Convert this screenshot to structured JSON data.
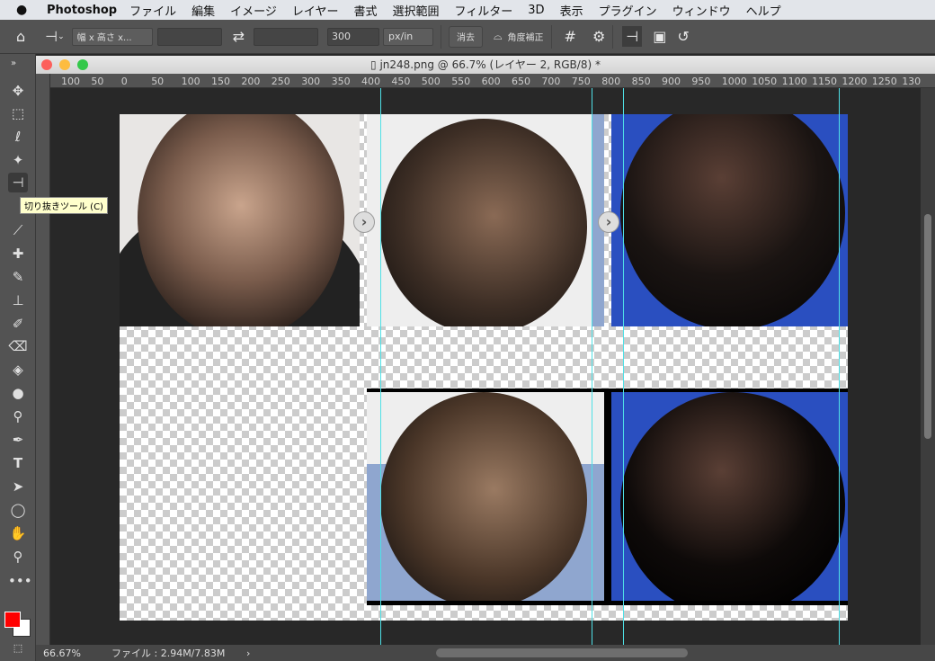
{
  "menubar": {
    "app": "Photoshop",
    "items": [
      "ファイル",
      "編集",
      "イメージ",
      "レイヤー",
      "書式",
      "選択範囲",
      "フィルター",
      "3D",
      "表示",
      "プラグイン",
      "ウィンドウ",
      "ヘルプ"
    ]
  },
  "options": {
    "ratio": "幅 x 高さ x...",
    "width": "",
    "height": "",
    "resolution": "300",
    "unit": "px/in",
    "clear": "消去",
    "straighten": "角度補正"
  },
  "document": {
    "title": "jn248.png @ 66.7% (レイヤー 2, RGB/8) *"
  },
  "ruler": {
    "h": [
      "100",
      "50",
      "0",
      "50",
      "100",
      "150",
      "200",
      "250",
      "300",
      "350",
      "400",
      "450",
      "500",
      "550",
      "600",
      "650",
      "700",
      "750",
      "800",
      "850",
      "900",
      "950",
      "1000",
      "1050",
      "1100",
      "1150",
      "1200",
      "1250",
      "130"
    ]
  },
  "tooltip": "切り抜きツール (C)",
  "status": {
    "zoom": "66.67%",
    "file": "ファイル : 2.94M/7.83M"
  },
  "colors": {
    "foreground": "#ff0000",
    "background": "#ffffff",
    "guide": "#4fe0e6"
  }
}
